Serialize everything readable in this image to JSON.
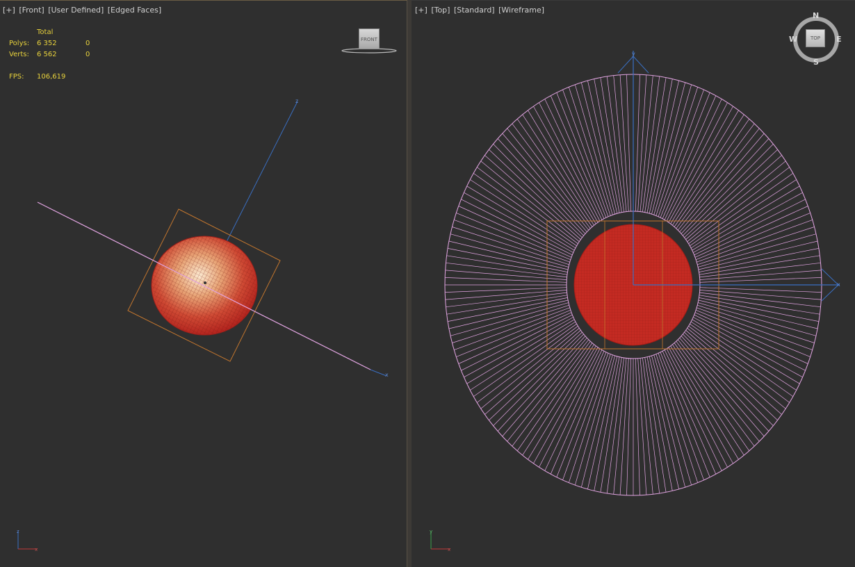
{
  "left_viewport": {
    "labels": [
      "[+]",
      "[Front]",
      "[User Defined]",
      "[Edged Faces]"
    ],
    "stats": {
      "header": "Total",
      "polys_label": "Polys:",
      "polys_total": "6 352",
      "polys_selected": "0",
      "verts_label": "Verts:",
      "verts_total": "6 562",
      "verts_selected": "0",
      "fps_label": "FPS:",
      "fps_value": "106,619"
    },
    "viewcube_label": "FRONT",
    "gizmo_axis_z": "z",
    "gizmo_axis_x": "x",
    "corner_axis_z": "z",
    "corner_axis_x": "x"
  },
  "right_viewport": {
    "labels": [
      "[+]",
      "[Top]",
      "[Standard]",
      "[Wireframe]"
    ],
    "viewcube_label": "TOP",
    "compass": {
      "n": "N",
      "s": "S",
      "e": "E",
      "w": "W"
    },
    "gizmo_axis_y": "y",
    "gizmo_axis_x": "x",
    "corner_axis_y": "y",
    "corner_axis_x": "x"
  },
  "colors": {
    "viewport_bg": "#2f2f2f",
    "stats_text": "#e8d23c",
    "wire_pink": "#e4a6e4",
    "sphere_red": "#c42a22",
    "bbox_orange": "#c2762e",
    "axis_blue": "#3a6fc2"
  }
}
